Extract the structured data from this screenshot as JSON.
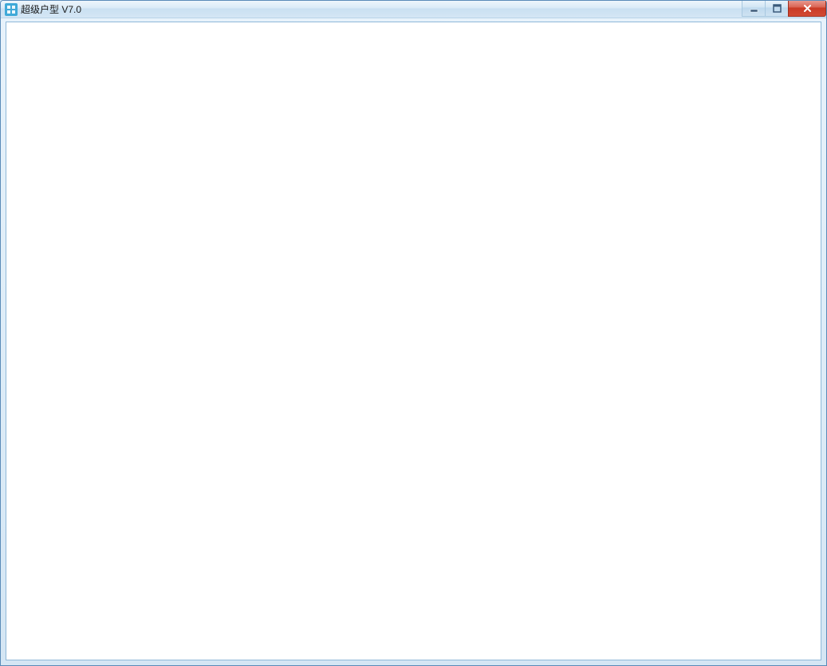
{
  "window": {
    "title": "超级户型 V7.0",
    "icon": "app-icon"
  },
  "controls": {
    "minimize": "minimize",
    "maximize": "maximize",
    "close": "close"
  }
}
